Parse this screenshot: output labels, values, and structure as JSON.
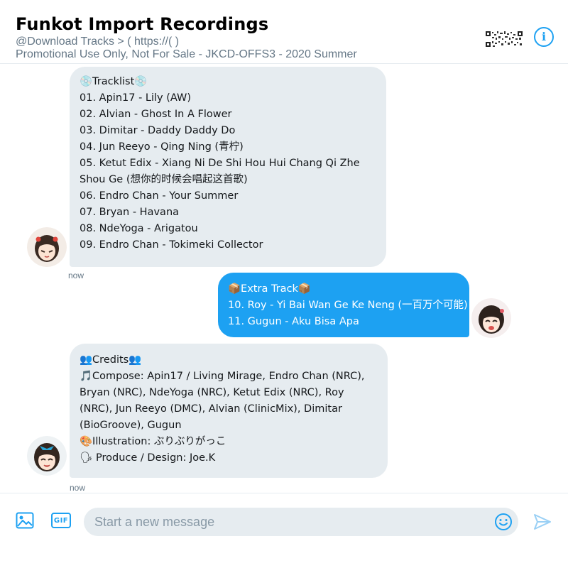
{
  "header": {
    "title": "Funkot Import Recordings",
    "subtitle_line1": "@Download Tracks > ( https://(                              )",
    "subtitle_line2": "Promotional Use Only, Not For Sale - JKCD-OFFS3 - 2020 Summer",
    "info_icon": "info-icon"
  },
  "messages": [
    {
      "direction": "incoming",
      "lines": [
        "💿Tracklist💿",
        "01. Apin17 - Lily (AW)",
        "02. Alvian - Ghost In A Flower",
        "03. Dimitar - Daddy Daddy Do",
        "04. Jun Reeyo - Qing Ning (青柠)",
        "05. Ketut Edix - Xiang Ni De Shi Hou Hui Chang Qi Zhe",
        "Shou Ge (想你的时候会唱起这首歌)",
        "06. Endro Chan - Your Summer",
        "07. Bryan - Havana",
        "08. NdeYoga - Arigatou",
        "09. Endro Chan - Tokimeki Collector"
      ],
      "timestamp": "now"
    },
    {
      "direction": "outgoing",
      "lines": [
        "📦Extra Track📦",
        "10. Roy - Yi Bai Wan Ge Ke Neng (一百万个可能)",
        "11. Gugun - Aku Bisa Apa"
      ]
    },
    {
      "direction": "incoming",
      "lines": [
        "👥Credits👥",
        "🎵Compose: Apin17 / Living Mirage, Endro Chan (NRC),",
        "Bryan (NRC), NdeYoga (NRC), Ketut Edix (NRC), Roy",
        "(NRC), Jun Reeyo (DMC), Alvian (ClinicMix), Dimitar",
        "(BioGroove), Gugun",
        "🎨Illustration: ぶりぶりがっこ",
        "🗣 Produce / Design: Joe.K"
      ],
      "timestamp": "now"
    }
  ],
  "composer": {
    "placeholder": "Start a new message",
    "gif_label": "GIF",
    "image_icon": "image-icon",
    "emoji_icon": "emoji-icon",
    "send_icon": "send-icon"
  },
  "colors": {
    "accent": "#1da1f2",
    "incoming_bubble": "#e6ecf0",
    "secondary_text": "#657786"
  }
}
